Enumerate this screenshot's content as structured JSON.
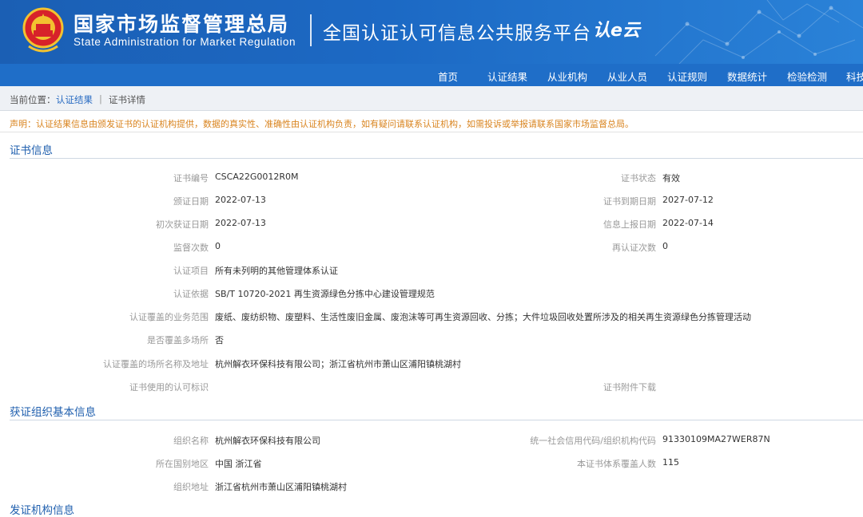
{
  "header": {
    "agency_cn": "国家市场监督管理总局",
    "agency_en": "State Administration  for  Market Regulation",
    "platform_title": "全国认证认可信息公共服务平台",
    "platform_logo": "认e云"
  },
  "nav": {
    "items": [
      "首页",
      "认证结果",
      "从业机构",
      "从业人员",
      "认证规则",
      "数据统计",
      "检验检测",
      "科技"
    ]
  },
  "breadcrumb": {
    "prefix": "当前位置：",
    "link": "认证结果",
    "sep": "|",
    "current": "证书详情"
  },
  "notice": "声明：认证结果信息由颁发证书的认证机构提供，数据的真实性、准确性由认证机构负责，如有疑问请联系认证机构，如需投诉或举报请联系国家市场监督总局。",
  "cert_section": {
    "title": "证书信息",
    "left_rows": [
      {
        "label": "证书编号",
        "value": "CSCA22G0012R0M"
      },
      {
        "label": "颁证日期",
        "value": "2022-07-13"
      },
      {
        "label": "初次获证日期",
        "value": "2022-07-13"
      },
      {
        "label": "监督次数",
        "value": "0"
      },
      {
        "label": "认证项目",
        "value": "所有未列明的其他管理体系认证"
      },
      {
        "label": "认证依据",
        "value": "SB/T 10720-2021 再生资源绿色分拣中心建设管理规范"
      },
      {
        "label": "认证覆盖的业务范围",
        "value": "废纸、废纺织物、废塑料、生活性废旧金属、废泡沫等可再生资源回收、分拣；大件垃圾回收处置所涉及的相关再生资源绿色分拣管理活动"
      },
      {
        "label": "是否覆盖多场所",
        "value": "否"
      },
      {
        "label": "认证覆盖的场所名称及地址",
        "value": "杭州解衣环保科技有限公司；浙江省杭州市萧山区浦阳镇桃湖村"
      },
      {
        "label": "证书使用的认可标识",
        "value": ""
      }
    ],
    "right_rows": [
      {
        "label": "证书状态",
        "value": "有效"
      },
      {
        "label": "证书到期日期",
        "value": "2027-07-12"
      },
      {
        "label": "信息上报日期",
        "value": "2022-07-14"
      },
      {
        "label": "再认证次数",
        "value": "0"
      },
      {
        "label": "证书附件下载",
        "value": ""
      }
    ]
  },
  "org_section": {
    "title": "获证组织基本信息",
    "left_rows": [
      {
        "label": "组织名称",
        "value": "杭州解衣环保科技有限公司"
      },
      {
        "label": "所在国别地区",
        "value": "中国 浙江省"
      },
      {
        "label": "组织地址",
        "value": "浙江省杭州市萧山区浦阳镇桃湖村"
      }
    ],
    "right_rows": [
      {
        "label": "统一社会信用代码/组织机构代码",
        "value": "91330109MA27WER87N"
      },
      {
        "label": "本证书体系覆盖人数",
        "value": "115"
      }
    ]
  },
  "next_section": {
    "title": "发证机构信息"
  },
  "colors": {
    "banner": "#1c69c4",
    "nav": "#1f6ec8",
    "section_title": "#1f5fae",
    "notice": "#d9841f",
    "link": "#2a6cc2"
  }
}
